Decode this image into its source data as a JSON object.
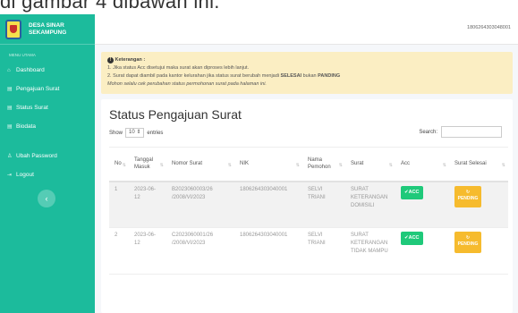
{
  "caption": "di gambar 4 dibawah ini.",
  "brand": {
    "line1": "DESA SINAR",
    "line2": "SEKAMPUNG"
  },
  "sidebar": {
    "header": "MENU UTAMA",
    "items": [
      {
        "label": "Dashboard",
        "icon": "home-icon"
      },
      {
        "label": "Pengajuan Surat",
        "icon": "document-icon"
      },
      {
        "label": "Status Surat",
        "icon": "document-icon"
      },
      {
        "label": "Biodata",
        "icon": "document-icon"
      },
      {
        "label": "Ubah Password",
        "icon": "user-icon"
      },
      {
        "label": "Logout",
        "icon": "logout-icon"
      }
    ],
    "collapse": "‹"
  },
  "topbar": {
    "user": "1806264303048001"
  },
  "alert": {
    "title": "Keterangan :",
    "line1": "1. Jika status Acc disetujui maka surat akan diproses lebih lanjut.",
    "line2_pre": "2. Surat dapat diambil pada kantor kelurahan jika status surat berubah menjadi ",
    "line2_selesai": "SELESAI",
    "line2_mid": " bukan ",
    "line2_pending": "PANDING",
    "line3": "Mohon selalu cek perubahan status permohonan surat pada halaman ini."
  },
  "card": {
    "title": "Status Pengajuan Surat",
    "show": "Show",
    "entries_value": "10",
    "entries": "entries",
    "search": "Search:"
  },
  "table": {
    "headers": [
      "No",
      "Tanggal Masuk",
      "Nomor Surat",
      "NIK",
      "Nama Pemohon",
      "Surat",
      "Acc",
      "Surat Selesai"
    ],
    "rows": [
      {
        "no": "1",
        "tanggal": "2023-06-12",
        "nomor": "B2023060003/26 /2008/VI/2023",
        "nik": "1806264303040001",
        "nama": "SELVI TRIANI",
        "surat": "SURAT KETERANGAN DOMISILI",
        "acc": "✔ACC",
        "selesai": "PENDING"
      },
      {
        "no": "2",
        "tanggal": "2023-06-12",
        "nomor": "C2023060001/26 /2008/VI/2023",
        "nik": "1806264303040001",
        "nama": "SELVI TRIANI",
        "surat": "SURAT KETERANGAN TIDAK MAMPU",
        "acc": "✔ACC",
        "selesai": "PENDING"
      }
    ]
  }
}
